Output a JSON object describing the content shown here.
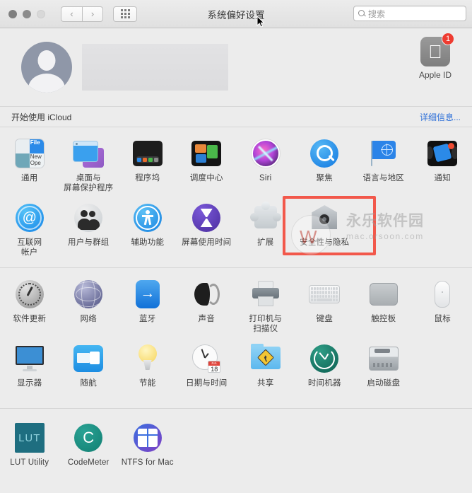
{
  "window": {
    "title": "系统偏好设置",
    "traffic_lights": [
      "close",
      "minimize",
      "zoom"
    ],
    "nav_back": "‹",
    "nav_forward": "›",
    "grid_button": "show-all-grid"
  },
  "search": {
    "placeholder": "搜索",
    "icon": "search-icon"
  },
  "account": {
    "avatar": "user-avatar-placeholder",
    "name_redacted": "",
    "apple_id_label": "Apple ID",
    "apple_id_badge": "1",
    "apple_icon": "apple-logo-icon"
  },
  "icloud": {
    "label": "开始使用 iCloud",
    "link": "详细信息..."
  },
  "highlight": {
    "color": "#f2584b",
    "target": "安全性与隐私"
  },
  "watermark": {
    "main": "永乐软件园",
    "sub": "mac.orsoon.com"
  },
  "sections": [
    {
      "id": "section-1",
      "rows": [
        [
          {
            "label": "通用",
            "icon": "general-icon"
          },
          {
            "label": "桌面与\n屏幕保护程序",
            "icon": "desktop-screensaver-icon"
          },
          {
            "label": "程序坞",
            "icon": "dock-icon"
          },
          {
            "label": "调度中心",
            "icon": "mission-control-icon"
          },
          {
            "label": "Siri",
            "icon": "siri-icon"
          },
          {
            "label": "聚焦",
            "icon": "spotlight-icon"
          },
          {
            "label": "语言与地区",
            "icon": "language-region-icon"
          },
          {
            "label": "通知",
            "icon": "notifications-icon"
          }
        ],
        [
          {
            "label": "互联网\n帐户",
            "icon": "internet-accounts-icon"
          },
          {
            "label": "用户与群组",
            "icon": "users-groups-icon"
          },
          {
            "label": "辅助功能",
            "icon": "accessibility-icon"
          },
          {
            "label": "屏幕使用时间",
            "icon": "screen-time-icon"
          },
          {
            "label": "扩展",
            "icon": "extensions-icon"
          },
          {
            "label": "安全性与隐私",
            "icon": "security-privacy-icon"
          }
        ]
      ]
    },
    {
      "id": "section-2",
      "rows": [
        [
          {
            "label": "软件更新",
            "icon": "software-update-icon"
          },
          {
            "label": "网络",
            "icon": "network-icon"
          },
          {
            "label": "蓝牙",
            "icon": "bluetooth-icon"
          },
          {
            "label": "声音",
            "icon": "sound-icon"
          },
          {
            "label": "打印机与\n扫描仪",
            "icon": "printers-scanners-icon"
          },
          {
            "label": "键盘",
            "icon": "keyboard-icon"
          },
          {
            "label": "触控板",
            "icon": "trackpad-icon"
          },
          {
            "label": "鼠标",
            "icon": "mouse-icon"
          }
        ],
        [
          {
            "label": "显示器",
            "icon": "displays-icon"
          },
          {
            "label": "随航",
            "icon": "sidecar-icon"
          },
          {
            "label": "节能",
            "icon": "energy-saver-icon"
          },
          {
            "label": "日期与时间",
            "icon": "date-time-icon",
            "calendar_month": "JUL",
            "calendar_day": "18"
          },
          {
            "label": "共享",
            "icon": "sharing-icon"
          },
          {
            "label": "时间机器",
            "icon": "time-machine-icon"
          },
          {
            "label": "启动磁盘",
            "icon": "startup-disk-icon"
          }
        ]
      ]
    },
    {
      "id": "section-3",
      "rows": [
        [
          {
            "label": "LUT Utility",
            "icon": "lut-utility-icon",
            "badge_text": "LUT"
          },
          {
            "label": "CodeMeter",
            "icon": "codemeter-icon"
          },
          {
            "label": "NTFS for Mac",
            "icon": "ntfs-for-mac-icon"
          }
        ]
      ]
    }
  ]
}
